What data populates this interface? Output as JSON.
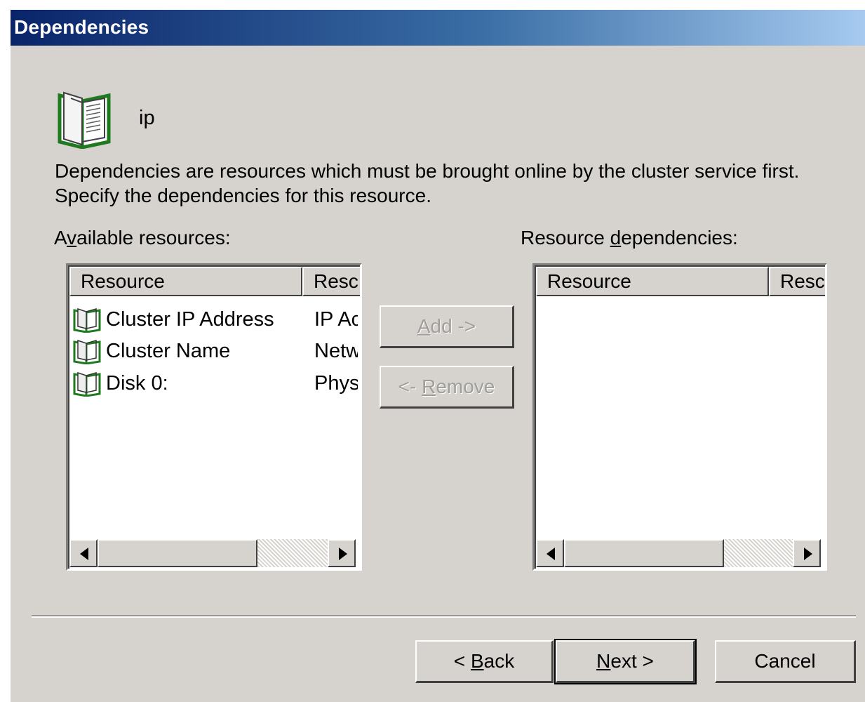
{
  "window": {
    "title": "Dependencies"
  },
  "resource": {
    "name": "ip",
    "icon": "book-icon"
  },
  "description": {
    "line1": "Dependencies are resources which must be brought online by the cluster service first.",
    "line2": "Specify the dependencies for this resource."
  },
  "available": {
    "label_pre": "A",
    "label_accel": "v",
    "label_post": "ailable resources:",
    "columns": [
      "Resource",
      "Resc"
    ],
    "items": [
      {
        "name": "Cluster IP Address",
        "type": "IP Ac"
      },
      {
        "name": "Cluster Name",
        "type": "Netw"
      },
      {
        "name": "Disk 0:",
        "type": "Phys"
      }
    ]
  },
  "dependencies": {
    "label_pre": "Resource ",
    "label_accel": "d",
    "label_post": "ependencies:",
    "columns": [
      "Resource",
      "Resc"
    ],
    "items": []
  },
  "buttons": {
    "add": {
      "accel": "A",
      "rest": "dd ->",
      "enabled": false
    },
    "remove": {
      "pre": "<- ",
      "accel": "R",
      "rest": "emove",
      "enabled": false
    },
    "back": {
      "pre": "< ",
      "accel": "B",
      "rest": "ack"
    },
    "next": {
      "accel": "N",
      "rest": "ext >"
    },
    "cancel": {
      "label": "Cancel"
    }
  },
  "colors": {
    "face": "#d6d3ce",
    "title_start": "#0a246a",
    "title_end": "#a6caf0",
    "icon_green": "#1f7a1f"
  }
}
